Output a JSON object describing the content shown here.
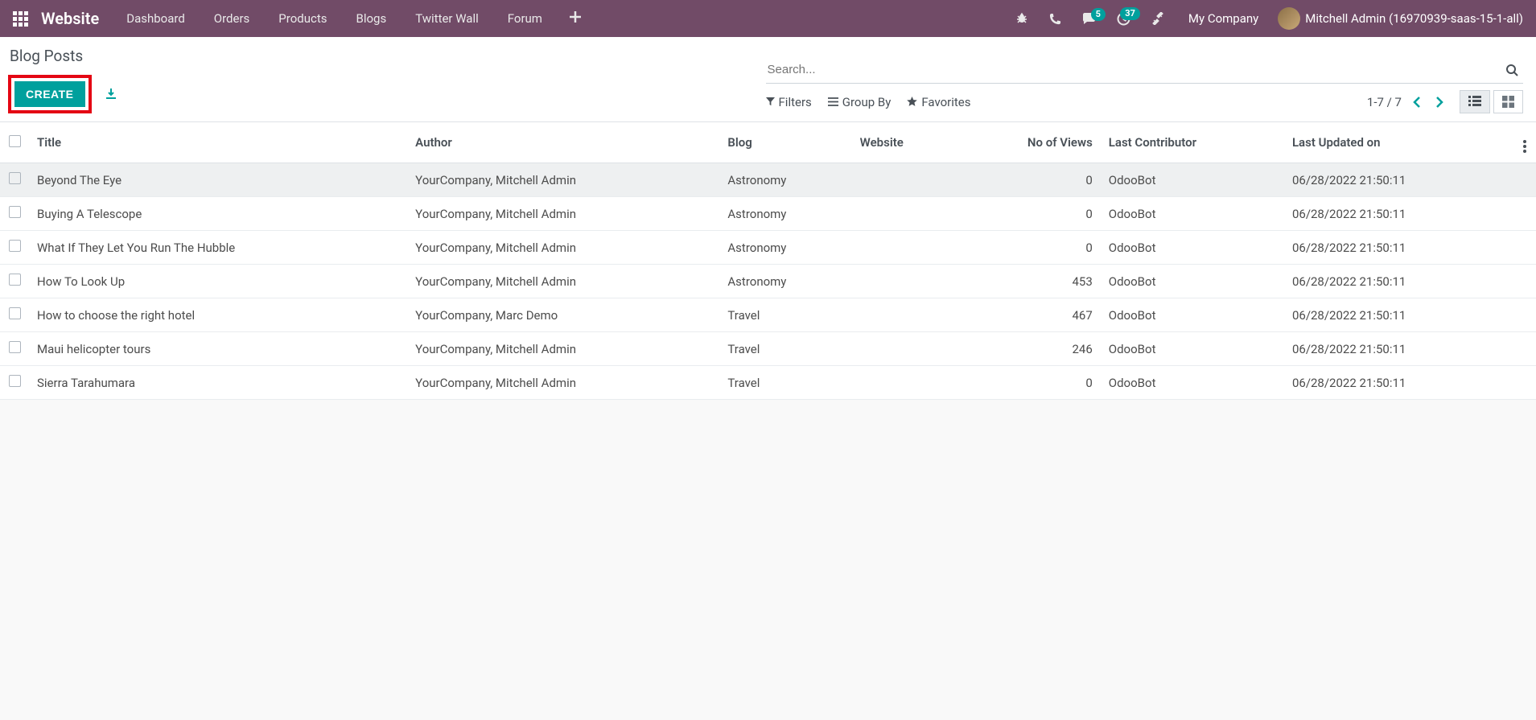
{
  "topbar": {
    "brand": "Website",
    "nav": [
      "Dashboard",
      "Orders",
      "Products",
      "Blogs",
      "Twitter Wall",
      "Forum"
    ],
    "msg_badge": "5",
    "activity_badge": "37",
    "company": "My Company",
    "user": "Mitchell Admin (16970939-saas-15-1-all)"
  },
  "cp": {
    "title": "Blog Posts",
    "create": "CREATE",
    "search_placeholder": "Search...",
    "filters": "Filters",
    "groupby": "Group By",
    "favorites": "Favorites",
    "pager": "1-7 / 7"
  },
  "table": {
    "headers": {
      "title": "Title",
      "author": "Author",
      "blog": "Blog",
      "website": "Website",
      "views": "No of Views",
      "contrib": "Last Contributor",
      "updated": "Last Updated on"
    },
    "rows": [
      {
        "title": "Beyond The Eye",
        "author": "YourCompany, Mitchell Admin",
        "blog": "Astronomy",
        "website": "",
        "views": "0",
        "contrib": "OdooBot",
        "updated": "06/28/2022 21:50:11"
      },
      {
        "title": "Buying A Telescope",
        "author": "YourCompany, Mitchell Admin",
        "blog": "Astronomy",
        "website": "",
        "views": "0",
        "contrib": "OdooBot",
        "updated": "06/28/2022 21:50:11"
      },
      {
        "title": "What If They Let You Run The Hubble",
        "author": "YourCompany, Mitchell Admin",
        "blog": "Astronomy",
        "website": "",
        "views": "0",
        "contrib": "OdooBot",
        "updated": "06/28/2022 21:50:11"
      },
      {
        "title": "How To Look Up",
        "author": "YourCompany, Mitchell Admin",
        "blog": "Astronomy",
        "website": "",
        "views": "453",
        "contrib": "OdooBot",
        "updated": "06/28/2022 21:50:11"
      },
      {
        "title": "How to choose the right hotel",
        "author": "YourCompany, Marc Demo",
        "blog": "Travel",
        "website": "",
        "views": "467",
        "contrib": "OdooBot",
        "updated": "06/28/2022 21:50:11"
      },
      {
        "title": "Maui helicopter tours",
        "author": "YourCompany, Mitchell Admin",
        "blog": "Travel",
        "website": "",
        "views": "246",
        "contrib": "OdooBot",
        "updated": "06/28/2022 21:50:11"
      },
      {
        "title": "Sierra Tarahumara",
        "author": "YourCompany, Mitchell Admin",
        "blog": "Travel",
        "website": "",
        "views": "0",
        "contrib": "OdooBot",
        "updated": "06/28/2022 21:50:11"
      }
    ]
  }
}
